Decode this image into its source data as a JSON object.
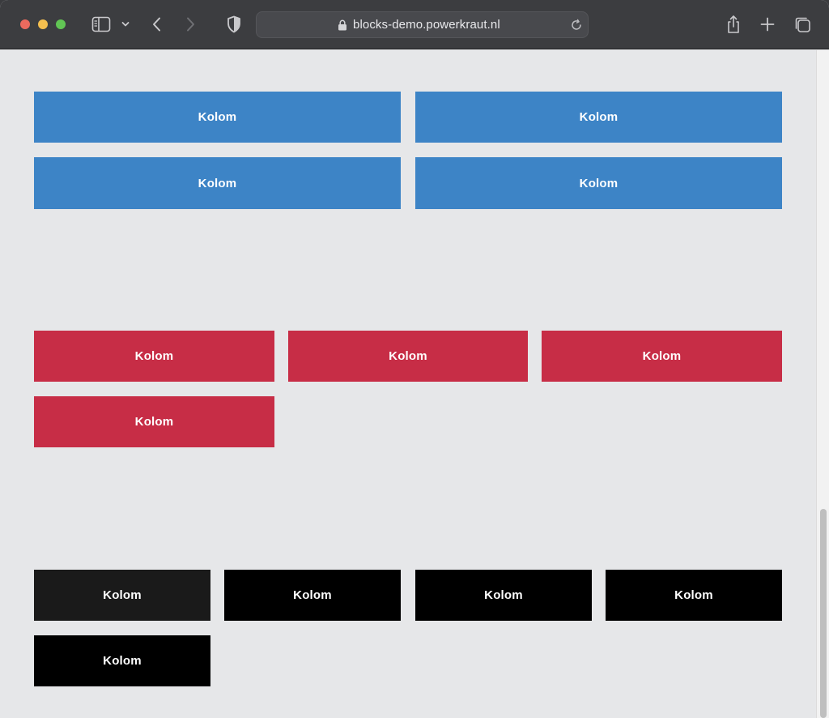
{
  "browser": {
    "url": "blocks-demo.powerkraut.nl",
    "icons": {
      "sidebar": "sidebar-icon",
      "chevron": "chevron-down-icon",
      "back": "back-arrow-icon",
      "forward": "forward-arrow-icon",
      "shield": "shield-icon",
      "lock": "lock-icon",
      "reload": "reload-icon",
      "share": "share-icon",
      "new_tab": "plus-icon",
      "tabs": "tabs-overview-icon"
    }
  },
  "colors": {
    "blue": "#3d84c6",
    "red": "#c72d46",
    "dark": "#1a1a1a",
    "black": "#000000",
    "page_bg": "#e6e7e9"
  },
  "sections": [
    {
      "name": "blue-grid",
      "columns": 2,
      "blocks": [
        {
          "label": "Kolom"
        },
        {
          "label": "Kolom"
        },
        {
          "label": "Kolom"
        },
        {
          "label": "Kolom"
        }
      ]
    },
    {
      "name": "red-grid",
      "columns": 3,
      "blocks": [
        {
          "label": "Kolom"
        },
        {
          "label": "Kolom"
        },
        {
          "label": "Kolom"
        },
        {
          "label": "Kolom"
        }
      ]
    },
    {
      "name": "black-grid",
      "columns": 4,
      "blocks": [
        {
          "label": "Kolom"
        },
        {
          "label": "Kolom"
        },
        {
          "label": "Kolom"
        },
        {
          "label": "Kolom"
        },
        {
          "label": "Kolom"
        }
      ]
    }
  ]
}
